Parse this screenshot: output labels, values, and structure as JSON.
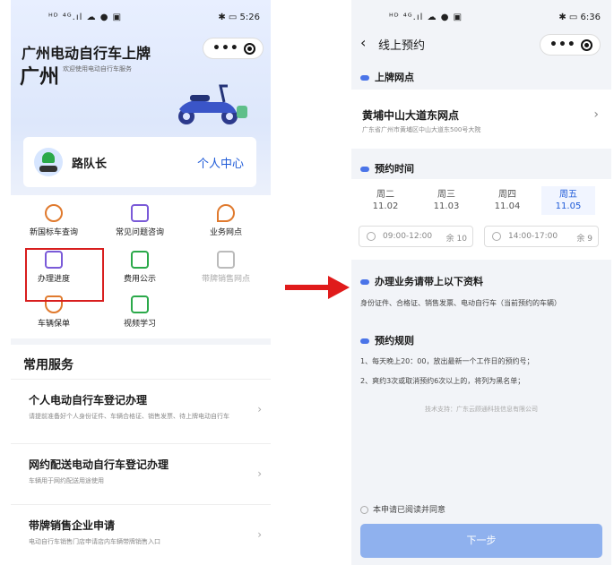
{
  "left_screen": {
    "status": {
      "left": "ᴴᴰ ⁴ᴳ.ıl ☁ ● ▣",
      "right": "✱ ▭ 5:26"
    },
    "title": "广州电动自行车上牌",
    "city": "广州",
    "subtitle": "欢迎使用电动自行车服务",
    "user_name": "路队长",
    "personal_center": "个人中心",
    "grid_items": [
      {
        "label": "新国标车查询",
        "icon": "badge-icon"
      },
      {
        "label": "常见问题咨询",
        "icon": "chat-icon"
      },
      {
        "label": "业务网点",
        "icon": "location-icon"
      },
      {
        "label": "办理进度",
        "icon": "progress-icon"
      },
      {
        "label": "费用公示",
        "icon": "document-icon"
      },
      {
        "label": "带牌销售网点",
        "icon": "card-icon"
      },
      {
        "label": "车辆保单",
        "icon": "shield-icon"
      },
      {
        "label": "视频学习",
        "icon": "book-icon"
      }
    ],
    "common_services_title": "常用服务",
    "services": [
      {
        "title": "个人电动自行车登记办理",
        "desc": "请提前准备好个人身份证件、车辆合格证、销售发票、待上牌电动自行车"
      },
      {
        "title": "网约配送电动自行车登记办理",
        "desc": "车辆用于网约配送用途使用"
      },
      {
        "title": "带牌销售企业申请",
        "desc": "电动自行车销售门店申请店内车辆带牌销售入口"
      }
    ]
  },
  "right_screen": {
    "status": {
      "left": "ᴴᴰ ⁴ᴳ.ıl ☁ ● ▣",
      "right": "✱ ▭ 6:36"
    },
    "title": "线上预约",
    "section_outlet": "上牌网点",
    "outlet_name": "黄埔中山大道东网点",
    "outlet_address": "广东省广州市黄埔区中山大道东500号大院",
    "section_time": "预约时间",
    "dates": [
      {
        "weekday": "周二",
        "date": "11.02"
      },
      {
        "weekday": "周三",
        "date": "11.03"
      },
      {
        "weekday": "周四",
        "date": "11.04"
      },
      {
        "weekday": "周五",
        "date": "11.05"
      }
    ],
    "slots": [
      {
        "time": "09:00-12:00",
        "remain": "余 10"
      },
      {
        "time": "14:00-17:00",
        "remain": "余 9"
      }
    ],
    "section_materials": "办理业务请带上以下资料",
    "materials_text": "身份证件、合格证、销售发票、电动自行车（当前预约的车辆）",
    "section_rules": "预约规则",
    "rule_1": "1、每天晚上20：00，放出最新一个工作日的预约号；",
    "rule_2": "2、爽约3次或取消预约6次以上的，将列为黑名单；",
    "tech_support": "技术支持：广东云顾通科技信息有限公司",
    "agree_text": "本申请已阅读并同意",
    "next_button": "下一步"
  },
  "colors": {
    "accent": "#1f5bd8",
    "highlight_box": "#d81e1e",
    "arrow": "#e01b1b",
    "button": "#8fb1ee"
  }
}
